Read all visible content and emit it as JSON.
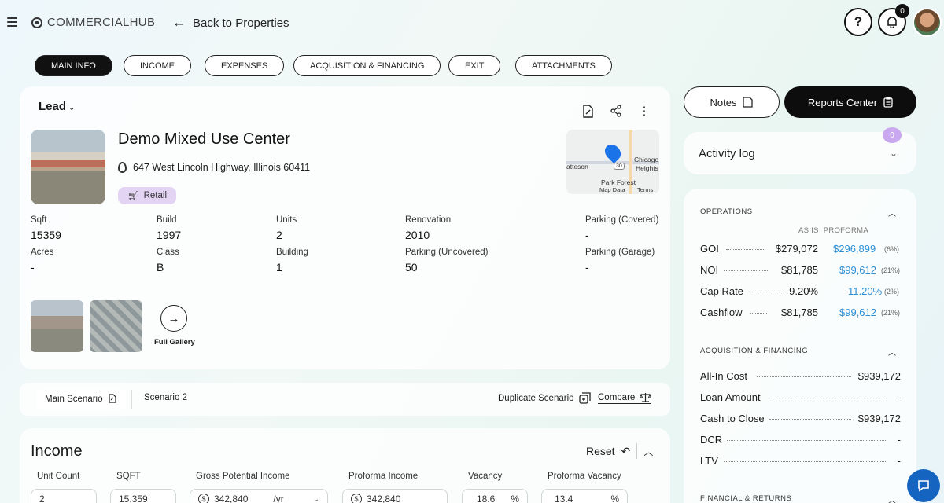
{
  "brand": "COMMERCIALHUB",
  "back_label": "Back to Properties",
  "notifications_count": "0",
  "tabs": [
    "MAIN INFO",
    "INCOME",
    "EXPENSES",
    "ACQUISITION & FINANCING",
    "EXIT",
    "ATTACHMENTS"
  ],
  "status": "Lead",
  "property": {
    "name": "Demo Mixed Use Center",
    "address": "647 West Lincoln Highway, Illinois 60411",
    "type": "Retail"
  },
  "map_labels": {
    "city1": "atteson",
    "city2": "Chicago",
    "city3": "Heights",
    "area": "Park Forest",
    "route": "30",
    "map_data": "Map Data",
    "terms": "Terms"
  },
  "stats": [
    {
      "label": "Sqft",
      "value": "15359"
    },
    {
      "label": "Build",
      "value": "1997"
    },
    {
      "label": "Units",
      "value": "2"
    },
    {
      "label": "Renovation",
      "value": "2010"
    },
    {
      "label": "Parking (Covered)",
      "value": "-"
    },
    {
      "label": "Acres",
      "value": "-"
    },
    {
      "label": "Class",
      "value": "B"
    },
    {
      "label": "Building",
      "value": "1"
    },
    {
      "label": "Parking (Uncovered)",
      "value": "50"
    },
    {
      "label": "Parking (Garage)",
      "value": "-"
    }
  ],
  "gallery_label": "Full Gallery",
  "scenarios": {
    "main": "Main Scenario",
    "second": "Scenario 2",
    "duplicate": "Duplicate Scenario",
    "compare": "Compare"
  },
  "income": {
    "title": "Income",
    "reset": "Reset",
    "columns": [
      "Unit Count",
      "SQFT",
      "Gross Potential Income",
      "Proforma Income",
      "Vacancy",
      "Proforma Vacancy"
    ],
    "unit_count": "2",
    "sqft": "15,359",
    "gpi": "342,840",
    "gpi_period": "/yr",
    "proforma_income": "342,840",
    "vacancy": "18.6",
    "proforma_vacancy": "13.4",
    "percent": "%"
  },
  "actions": {
    "notes": "Notes",
    "reports": "Reports Center"
  },
  "activity": {
    "title": "Activity log",
    "count": "0"
  },
  "operations": {
    "title": "OPERATIONS",
    "col_asis": "AS IS",
    "col_proforma": "PROFORMA",
    "rows": [
      {
        "name": "GOI",
        "asis": "$279,072",
        "proforma": "$296,899",
        "pct": "(6%)"
      },
      {
        "name": "NOI",
        "asis": "$81,785",
        "proforma": "$99,612",
        "pct": "(21%)"
      },
      {
        "name": "Cap Rate",
        "asis": "9.20%",
        "proforma": "11.20%",
        "pct": "(2%)"
      },
      {
        "name": "Cashflow",
        "asis": "$81,785",
        "proforma": "$99,612",
        "pct": "(21%)"
      }
    ]
  },
  "acquisition": {
    "title": "ACQUISITION & FINANCING",
    "rows": [
      {
        "name": "All-In Cost",
        "value": "$939,172"
      },
      {
        "name": "Loan Amount",
        "value": "-"
      },
      {
        "name": "Cash to Close",
        "value": "$939,172"
      },
      {
        "name": "DCR",
        "value": "-"
      },
      {
        "name": "LTV",
        "value": "-"
      }
    ]
  },
  "financial": {
    "title": "FINANCIAL & RETURNS"
  },
  "colors": {
    "accent": "#2b8fd6",
    "dark": "#0d0d0d",
    "tag_bg": "#e4d4f4",
    "chat": "#1565c0"
  }
}
